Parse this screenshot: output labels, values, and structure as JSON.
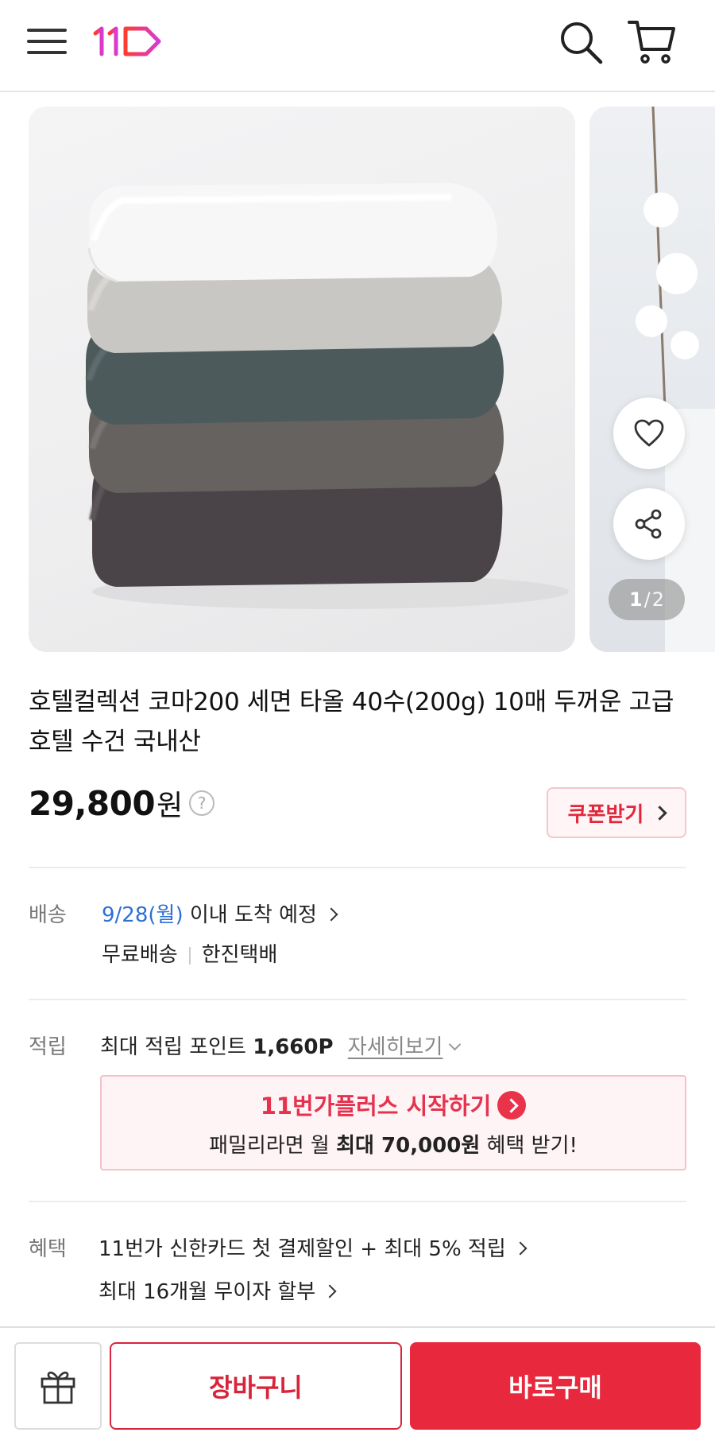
{
  "header": {
    "menu_icon": "hamburger-menu-icon",
    "logo_icon": "11st-logo",
    "search_icon": "search-icon",
    "cart_icon": "cart-icon"
  },
  "carousel": {
    "current": "1",
    "separator": "/",
    "total": "2",
    "wishlist_icon": "heart-icon",
    "share_icon": "share-icon"
  },
  "product": {
    "title": "호텔컬렉션 코마200 세면 타올 40수(200g) 10매 두꺼운 고급 호텔 수건 국내산",
    "price": "29,800",
    "currency": "원",
    "help": "?",
    "coupon_label": "쿠폰받기"
  },
  "delivery": {
    "label": "배송",
    "date": "9/28(월)",
    "arrival": " 이내 도착 예정",
    "fee": "무료배송",
    "carrier": "한진택배"
  },
  "points": {
    "label": "적립",
    "text": "최대 적립 포인트 ",
    "amount": "1,660P",
    "detail_link": "자세히보기"
  },
  "plus_promo": {
    "brand": "11번가플러스",
    "action": " 시작하기",
    "sub_prefix": "패밀리라면 월 ",
    "sub_bold": "최대 70,000원",
    "sub_suffix": " 혜택 받기!"
  },
  "benefits": {
    "label": "혜택",
    "line1": "11번가 신한카드 첫 결제할인 + 최대 5% 적립",
    "line2": "최대 16개월 무이자 할부"
  },
  "bottom_bar": {
    "gift_icon": "gift-icon",
    "cart_button": "장바구니",
    "buy_button": "바로구매"
  },
  "colors": {
    "accent": "#e8293d",
    "link_blue": "#2f6fd6"
  }
}
